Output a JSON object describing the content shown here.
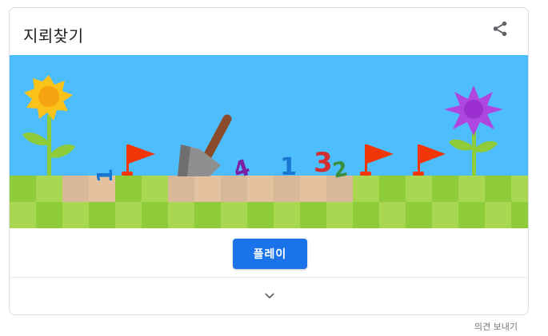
{
  "card": {
    "title": "지뢰찾기",
    "share_icon": "share-icon",
    "play_label": "플레이",
    "expand_icon": "chevron-down-icon"
  },
  "game_preview": {
    "numbers_shown": [
      "1",
      "4",
      "1",
      "3",
      "2"
    ],
    "colors": {
      "sky": "#4ebdfb",
      "grass_light": "#a9d751",
      "grass_dark": "#8ecc39",
      "dirt_light": "#e5c29f",
      "dirt_dark": "#d7b899",
      "flag": "#f23607",
      "sunflower": "#fbc219",
      "purple_flower": "#b046e0"
    }
  },
  "footer": {
    "feedback_label": "의견 보내기"
  },
  "colors": {
    "accent": "#1a73e8",
    "border": "#dadce0",
    "text": "#202124",
    "muted": "#70757a"
  }
}
